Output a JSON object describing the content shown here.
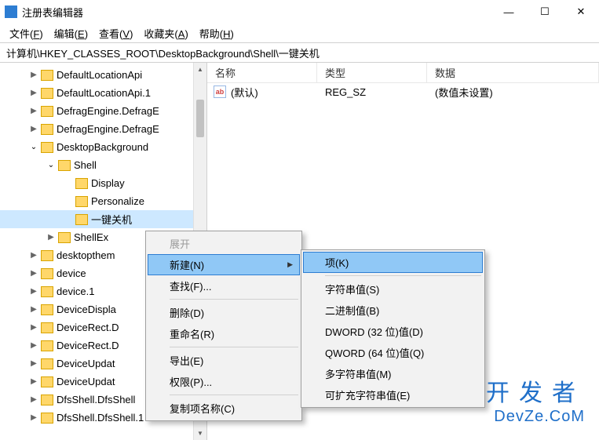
{
  "window": {
    "title": "注册表编辑器",
    "controls": {
      "min": "—",
      "max": "☐",
      "close": "✕"
    }
  },
  "menubar": {
    "file": {
      "label": "文件",
      "accel": "F"
    },
    "edit": {
      "label": "编辑",
      "accel": "E"
    },
    "view": {
      "label": "查看",
      "accel": "V"
    },
    "favorites": {
      "label": "收藏夹",
      "accel": "A"
    },
    "help": {
      "label": "帮助",
      "accel": "H"
    }
  },
  "address": "计算机\\HKEY_CLASSES_ROOT\\DesktopBackground\\Shell\\一键关机",
  "tree": {
    "items": [
      {
        "indent": 36,
        "exp": ">",
        "label": "DefaultLocationApi"
      },
      {
        "indent": 36,
        "exp": ">",
        "label": "DefaultLocationApi.1"
      },
      {
        "indent": 36,
        "exp": ">",
        "label": "DefragEngine.DefragE"
      },
      {
        "indent": 36,
        "exp": ">",
        "label": "DefragEngine.DefragE"
      },
      {
        "indent": 36,
        "exp": "v",
        "label": "DesktopBackground"
      },
      {
        "indent": 58,
        "exp": "v",
        "label": "Shell"
      },
      {
        "indent": 80,
        "exp": "",
        "label": "Display"
      },
      {
        "indent": 80,
        "exp": "",
        "label": "Personalize"
      },
      {
        "indent": 80,
        "exp": "",
        "label": "一键关机",
        "sel": true
      },
      {
        "indent": 58,
        "exp": ">",
        "label": "ShellEx"
      },
      {
        "indent": 36,
        "exp": ">",
        "label": "desktopthem"
      },
      {
        "indent": 36,
        "exp": ">",
        "label": "device"
      },
      {
        "indent": 36,
        "exp": ">",
        "label": "device.1"
      },
      {
        "indent": 36,
        "exp": ">",
        "label": "DeviceDispla"
      },
      {
        "indent": 36,
        "exp": ">",
        "label": "DeviceRect.D"
      },
      {
        "indent": 36,
        "exp": ">",
        "label": "DeviceRect.D"
      },
      {
        "indent": 36,
        "exp": ">",
        "label": "DeviceUpdat"
      },
      {
        "indent": 36,
        "exp": ">",
        "label": "DeviceUpdat"
      },
      {
        "indent": 36,
        "exp": ">",
        "label": "DfsShell.DfsShell"
      },
      {
        "indent": 36,
        "exp": ">",
        "label": "DfsShell.DfsShell.1"
      }
    ]
  },
  "list": {
    "headers": {
      "name": "名称",
      "type": "类型",
      "data": "数据"
    },
    "rows": [
      {
        "name": "(默认)",
        "type": "REG_SZ",
        "data": "(数值未设置)"
      }
    ]
  },
  "context1": {
    "items": [
      {
        "label": "展开",
        "disabled": true
      },
      {
        "label": "新建(N)",
        "arrow": true,
        "hl": true
      },
      {
        "label": "查找(F)..."
      },
      {
        "sep": true
      },
      {
        "label": "删除(D)"
      },
      {
        "label": "重命名(R)"
      },
      {
        "sep": true
      },
      {
        "label": "导出(E)"
      },
      {
        "label": "权限(P)..."
      },
      {
        "sep": true
      },
      {
        "label": "复制项名称(C)"
      }
    ]
  },
  "context2": {
    "items": [
      {
        "label": "项(K)",
        "hl": true
      },
      {
        "sep": true
      },
      {
        "label": "字符串值(S)"
      },
      {
        "label": "二进制值(B)"
      },
      {
        "label": "DWORD (32 位)值(D)"
      },
      {
        "label": "QWORD (64 位)值(Q)"
      },
      {
        "label": "多字符串值(M)"
      },
      {
        "label": "可扩充字符串值(E)"
      }
    ]
  },
  "watermark": {
    "line1": "开发者",
    "line2": "DevZe.CoM"
  },
  "icons": {
    "ab": "ab"
  }
}
